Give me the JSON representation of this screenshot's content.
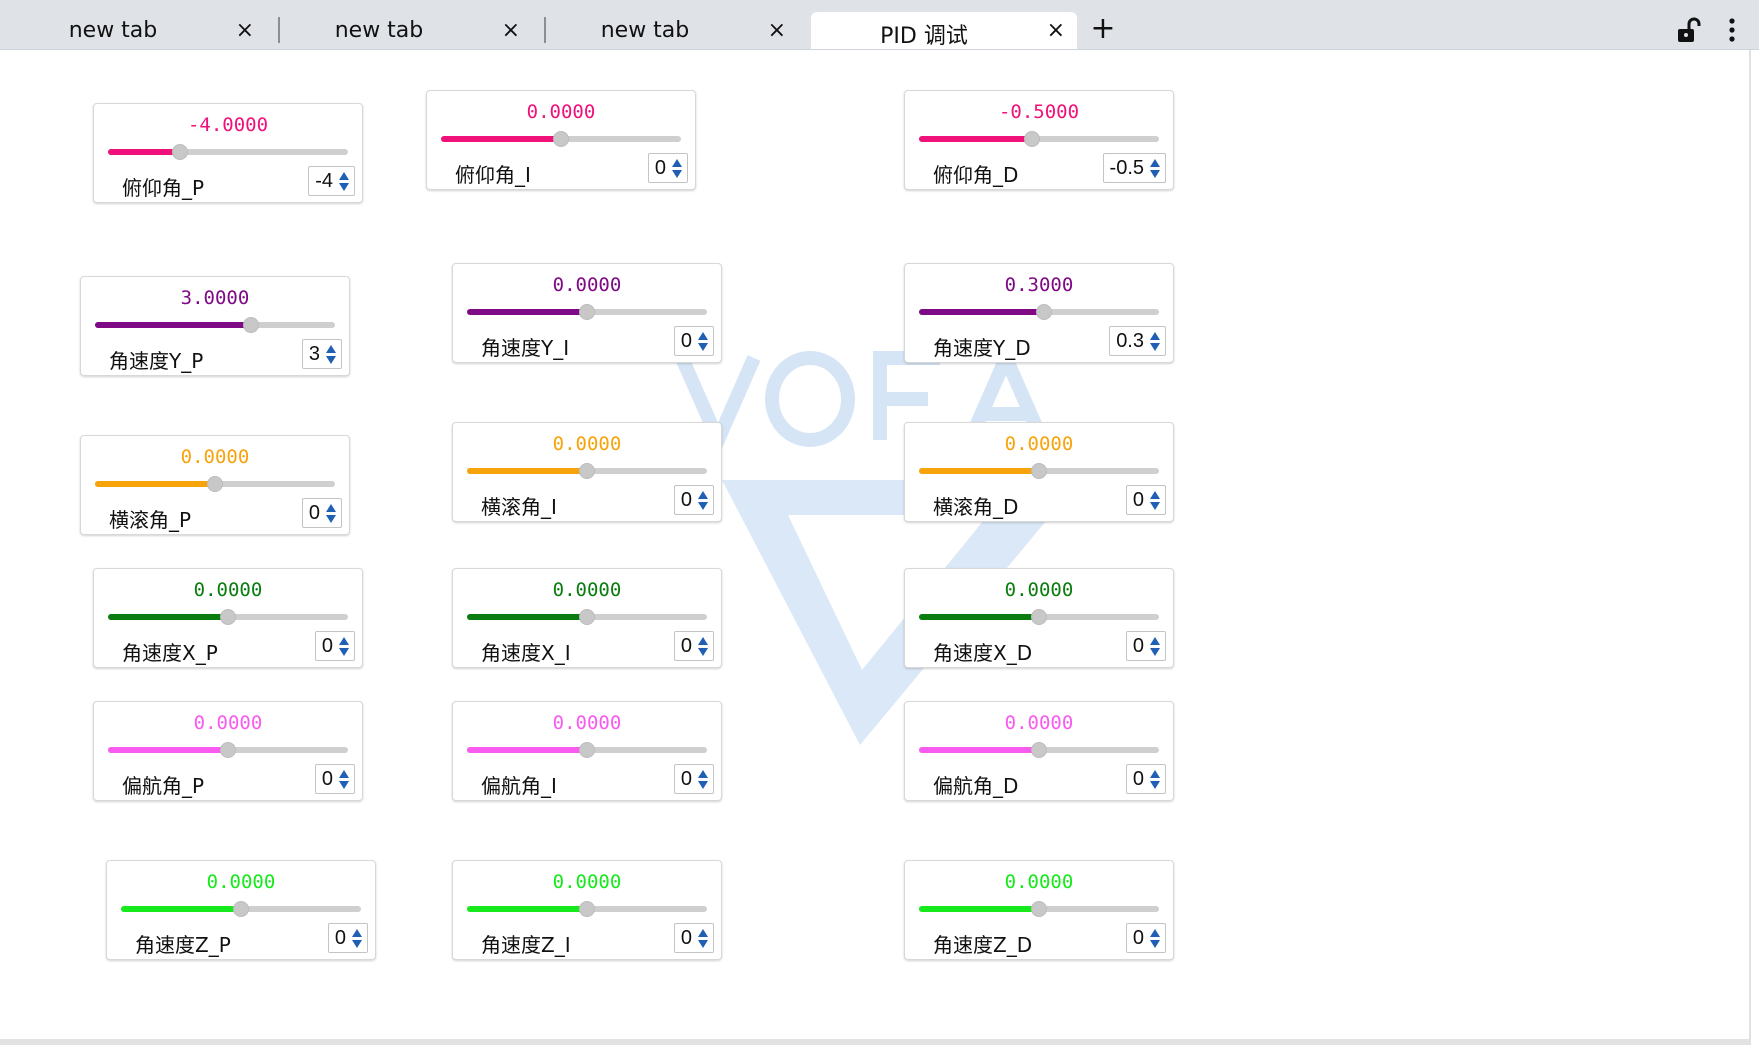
{
  "tabs": [
    {
      "label": "new tab",
      "close": "×"
    },
    {
      "label": "new tab",
      "close": "×"
    },
    {
      "label": "new tab",
      "close": "×"
    },
    {
      "label": "PID 调试",
      "close": "×"
    }
  ],
  "active_tab": 3,
  "new_tab_label": "+",
  "icons": {
    "lock": "lock-open-icon",
    "menu": "more-vertical-icon",
    "spin": "spinner-arrows-icon"
  },
  "watermark_text": "VOFA",
  "widgets": [
    {
      "label": "俯仰角_P",
      "display": "-4.0000",
      "field": "-4",
      "fill_fraction": 0.3,
      "color": "#f0117a"
    },
    {
      "label": "俯仰角_I",
      "display": "0.0000",
      "field": "0",
      "fill_fraction": 0.5,
      "color": "#f0117a"
    },
    {
      "label": "俯仰角_D",
      "display": "-0.5000",
      "field": "-0.5",
      "fill_fraction": 0.47,
      "color": "#f0117a"
    },
    {
      "label": "角速度Y_P",
      "display": "3.0000",
      "field": "3",
      "fill_fraction": 0.65,
      "color": "#7f0a85"
    },
    {
      "label": "角速度Y_I",
      "display": "0.0000",
      "field": "0",
      "fill_fraction": 0.5,
      "color": "#7f0a85"
    },
    {
      "label": "角速度Y_D",
      "display": "0.3000",
      "field": "0.3",
      "fill_fraction": 0.52,
      "color": "#7f0a85"
    },
    {
      "label": "横滚角_P",
      "display": "0.0000",
      "field": "0",
      "fill_fraction": 0.5,
      "color": "#f7a30b"
    },
    {
      "label": "横滚角_I",
      "display": "0.0000",
      "field": "0",
      "fill_fraction": 0.5,
      "color": "#f7a30b"
    },
    {
      "label": "横滚角_D",
      "display": "0.0000",
      "field": "0",
      "fill_fraction": 0.5,
      "color": "#f7a30b"
    },
    {
      "label": "角速度X_P",
      "display": "0.0000",
      "field": "0",
      "fill_fraction": 0.5,
      "color": "#0b7d10"
    },
    {
      "label": "角速度X_I",
      "display": "0.0000",
      "field": "0",
      "fill_fraction": 0.5,
      "color": "#0b7d10"
    },
    {
      "label": "角速度X_D",
      "display": "0.0000",
      "field": "0",
      "fill_fraction": 0.5,
      "color": "#0b7d10"
    },
    {
      "label": "偏航角_P",
      "display": "0.0000",
      "field": "0",
      "fill_fraction": 0.5,
      "color": "#f95af0"
    },
    {
      "label": "偏航角_I",
      "display": "0.0000",
      "field": "0",
      "fill_fraction": 0.5,
      "color": "#f95af0"
    },
    {
      "label": "偏航角_D",
      "display": "0.0000",
      "field": "0",
      "fill_fraction": 0.5,
      "color": "#f95af0"
    },
    {
      "label": "角速度Z_P",
      "display": "0.0000",
      "field": "0",
      "fill_fraction": 0.5,
      "color": "#17ea1c"
    },
    {
      "label": "角速度Z_I",
      "display": "0.0000",
      "field": "0",
      "fill_fraction": 0.5,
      "color": "#17ea1c"
    },
    {
      "label": "角速度Z_D",
      "display": "0.0000",
      "field": "0",
      "fill_fraction": 0.5,
      "color": "#17ea1c"
    }
  ]
}
